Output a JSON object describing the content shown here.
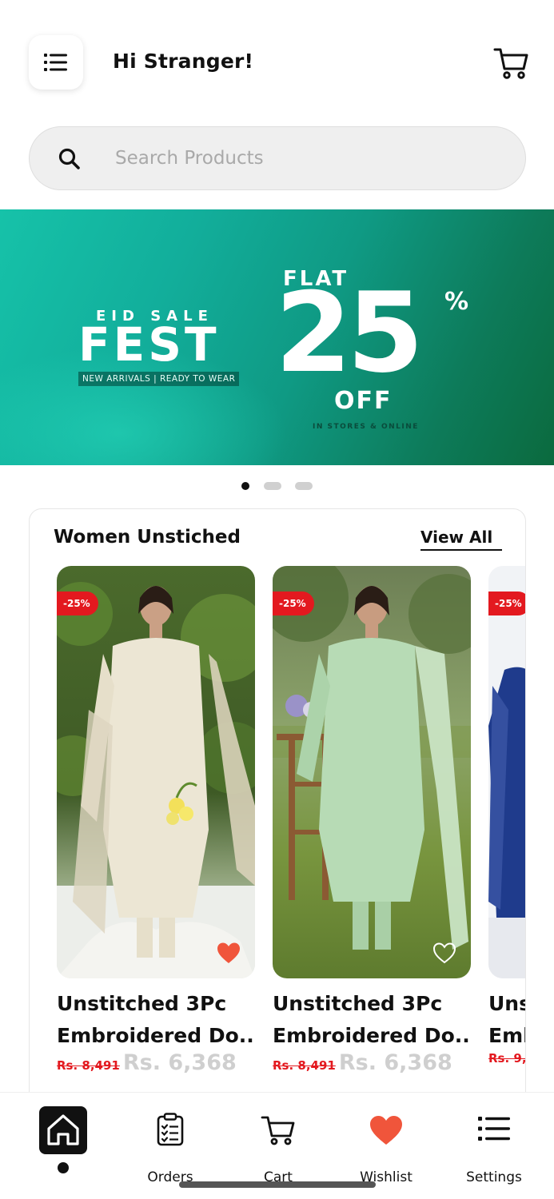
{
  "header": {
    "greeting": "Hi Stranger!",
    "menu_icon": "hamburger-menu-icon",
    "cart_icon": "cart-icon"
  },
  "search": {
    "placeholder": "Search Products",
    "icon": "search-icon"
  },
  "banner": {
    "eid_text": "EID SALE",
    "fest_text": "FEST",
    "tagline": "NEW ARRIVALS | READY TO WEAR",
    "flat_text": "FLAT",
    "discount_number": "25",
    "percent": "%",
    "off_text": "OFF",
    "stores_text": "IN STORES & ONLINE",
    "carousel_total": 3,
    "carousel_active_index": 0
  },
  "section": {
    "title": "Women Unstiched",
    "view_all": "View All",
    "products": [
      {
        "badge": "-25%",
        "name_line1": "Unstitched 3Pc",
        "name_line2": "Embroidered Do...",
        "old_price": "Rs. 8,491",
        "new_price": "Rs. 6,368",
        "wishlisted": true
      },
      {
        "badge": "-25%",
        "name_line1": "Unstitched 3Pc",
        "name_line2": "Embroidered Do...",
        "old_price": "Rs. 8,491",
        "new_price": "Rs. 6,368",
        "wishlisted": false
      },
      {
        "badge": "-25%",
        "name_line1": "Uns",
        "name_line2": "Eml",
        "old_price": "Rs. 9,",
        "new_price": "",
        "wishlisted": false
      }
    ]
  },
  "bottom_nav": {
    "items": [
      {
        "label": "",
        "icon": "home-icon",
        "active": true
      },
      {
        "label": "Orders",
        "icon": "clipboard-icon",
        "active": false
      },
      {
        "label": "Cart",
        "icon": "cart-icon",
        "active": false
      },
      {
        "label": "Wishlist",
        "icon": "heart-icon",
        "active": false
      },
      {
        "label": "Settings",
        "icon": "settings-list-icon",
        "active": false
      }
    ]
  },
  "colors": {
    "accent_red": "#e3191f",
    "heart_orange": "#f0553b",
    "banner_teal": "#12ae9b",
    "banner_green": "#0b6a3e"
  }
}
